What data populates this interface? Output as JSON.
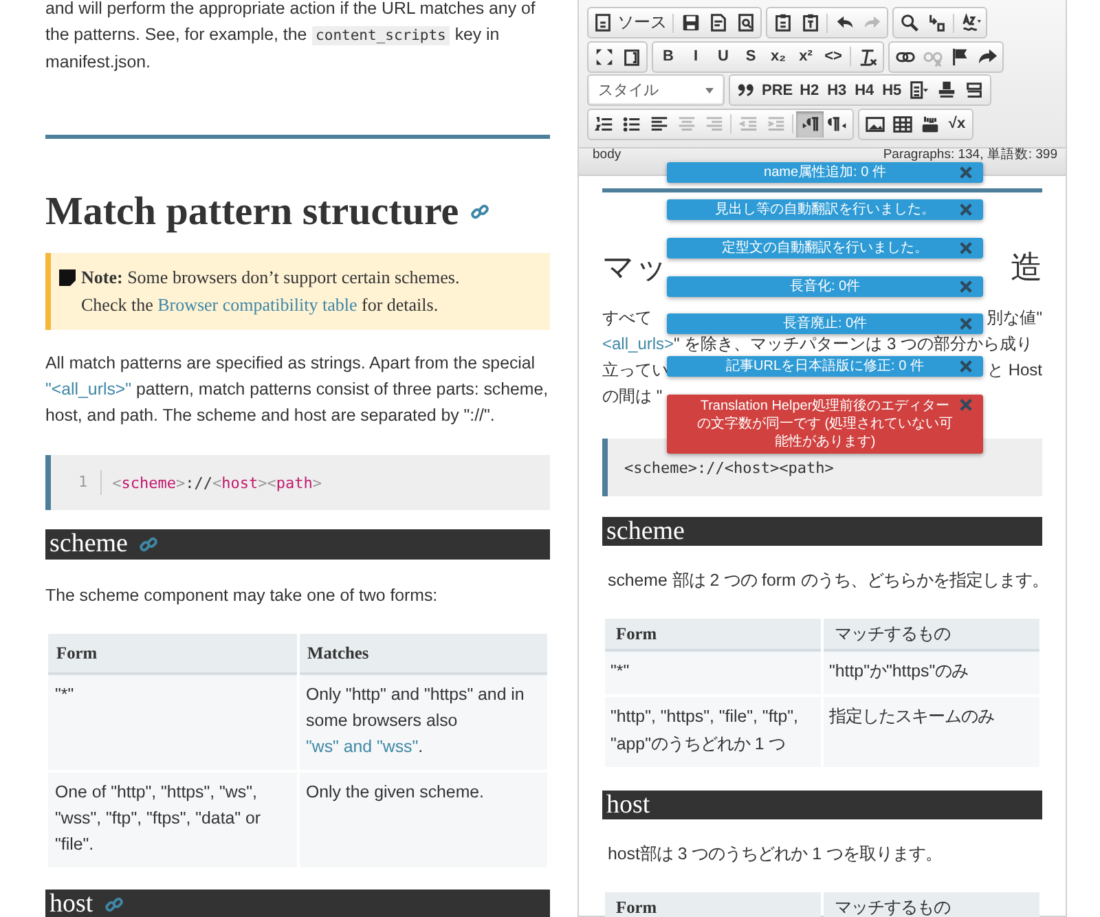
{
  "article": {
    "intro": [
      {
        "text": "and will perform the appropriate action if the URL matches any of the patterns. See, for example, the "
      },
      {
        "text": "content_scripts",
        "kind": "code"
      },
      {
        "text": " key in manifest.json."
      }
    ],
    "heading": "Match pattern structure",
    "note": [
      [
        {
          "text": "Note:",
          "kind": "bold"
        },
        {
          "text": " Some browsers don’t support certain schemes."
        }
      ],
      [
        {
          "text": "Check the "
        },
        {
          "text": "Browser compatibility table",
          "kind": "link"
        },
        {
          "text": " for details."
        }
      ]
    ],
    "paragraph": [
      {
        "text": "All match patterns are specified as strings. Apart from the special "
      },
      {
        "text": "\"<all_urls>\"",
        "kind": "link"
      },
      {
        "text": " pattern, match patterns consist of three parts: scheme, host, and path. The scheme and host are separated by \"://\"."
      }
    ],
    "code": {
      "line_number": "1",
      "tokens": [
        {
          "text": "<",
          "kind": "punct"
        },
        {
          "text": "scheme",
          "kind": "tag"
        },
        {
          "text": ">",
          "kind": "punct"
        },
        {
          "text": "://",
          "kind": "plain"
        },
        {
          "text": "<",
          "kind": "punct"
        },
        {
          "text": "host",
          "kind": "tag"
        },
        {
          "text": ">",
          "kind": "punct"
        },
        {
          "text": "<",
          "kind": "punct"
        },
        {
          "text": "path",
          "kind": "tag"
        },
        {
          "text": ">",
          "kind": "punct"
        }
      ]
    },
    "sections": [
      {
        "heading": "scheme",
        "text": "The scheme component may take one of two forms:",
        "table": {
          "columns": [
            "Form",
            "Matches"
          ],
          "rows": [
            [
              [
                {
                  "text": "\"*\""
                }
              ],
              [
                {
                  "text": "Only \"http\" and \"https\" and in some browsers also "
                },
                {
                  "text": "\"ws\" and \"wss\"",
                  "kind": "link"
                },
                {
                  "text": "."
                }
              ]
            ],
            [
              [
                {
                  "text": "One of \"http\", \"https\", \"ws\", \"wss\", \"ftp\", \"ftps\", \"data\" or \"file\"."
                }
              ],
              [
                {
                  "text": "Only the given scheme."
                }
              ]
            ]
          ]
        }
      },
      {
        "heading": "host"
      }
    ]
  },
  "editor": {
    "toolbar": [
      [
        [
          {
            "kind": "labeled",
            "label": "ソース",
            "disabled": false
          },
          {
            "kind": "separator"
          },
          {
            "kind": "icon",
            "disabled": false
          },
          {
            "kind": "icon",
            "disabled": false
          },
          {
            "kind": "icon",
            "disabled": false
          }
        ],
        [
          {
            "kind": "icon",
            "disabled": false
          },
          {
            "kind": "icon",
            "disabled": false
          },
          {
            "kind": "separator"
          },
          {
            "kind": "icon",
            "disabled": false
          },
          {
            "kind": "icon",
            "disabled": true
          }
        ],
        [
          {
            "kind": "icon",
            "disabled": false
          },
          {
            "kind": "icon",
            "disabled": false
          },
          {
            "kind": "separator"
          },
          {
            "kind": "icon",
            "disabled": false
          }
        ]
      ],
      [
        [
          {
            "kind": "icon",
            "disabled": false,
            "selected": false
          },
          {
            "kind": "icon",
            "disabled": false,
            "selected": false
          }
        ],
        [
          {
            "kind": "text",
            "label": "B",
            "disabled": false,
            "selected": false
          },
          {
            "kind": "text",
            "label": "I",
            "disabled": false,
            "selected": false
          },
          {
            "kind": "text",
            "label": "U",
            "disabled": false,
            "selected": false
          },
          {
            "kind": "text",
            "label": "S",
            "disabled": false,
            "selected": false
          },
          {
            "kind": "text",
            "label": "x₂",
            "disabled": false,
            "selected": false
          },
          {
            "kind": "text",
            "label": "x²",
            "disabled": false,
            "selected": false
          },
          {
            "kind": "text",
            "label": "<>",
            "disabled": false,
            "selected": false
          },
          {
            "kind": "separator"
          },
          {
            "kind": "icon",
            "disabled": false,
            "selected": false
          }
        ],
        [
          {
            "kind": "icon",
            "disabled": false,
            "selected": false
          },
          {
            "kind": "icon",
            "disabled": true,
            "selected": false
          },
          {
            "kind": "icon",
            "disabled": false,
            "selected": false
          },
          {
            "kind": "icon",
            "disabled": false,
            "selected": false
          }
        ]
      ],
      [
        [
          {
            "kind": "select",
            "label": "スタイル"
          }
        ],
        [
          {
            "kind": "icon",
            "disabled": false,
            "selected": false
          },
          {
            "kind": "text",
            "label": "PRE",
            "disabled": false,
            "selected": false
          },
          {
            "kind": "text",
            "label": "H2",
            "disabled": false,
            "selected": false
          },
          {
            "kind": "text",
            "label": "H3",
            "disabled": false,
            "selected": false
          },
          {
            "kind": "text",
            "label": "H4",
            "disabled": false,
            "selected": false
          },
          {
            "kind": "text",
            "label": "H5",
            "disabled": false,
            "selected": false
          },
          {
            "kind": "icon",
            "disabled": false,
            "selected": false
          },
          {
            "kind": "icon",
            "disabled": false,
            "selected": false
          },
          {
            "kind": "icon",
            "disabled": false,
            "selected": false
          }
        ]
      ],
      [
        [
          {
            "kind": "icon",
            "disabled": false,
            "selected": false
          },
          {
            "kind": "icon",
            "disabled": false,
            "selected": false
          },
          {
            "kind": "icon",
            "disabled": false,
            "selected": false
          },
          {
            "kind": "icon",
            "disabled": true,
            "selected": false
          },
          {
            "kind": "icon",
            "disabled": true,
            "selected": false
          },
          {
            "kind": "separator"
          },
          {
            "kind": "icon",
            "disabled": true,
            "selected": false
          },
          {
            "kind": "icon",
            "disabled": true,
            "selected": false
          },
          {
            "kind": "separator"
          },
          {
            "kind": "icon",
            "disabled": false,
            "selected": true
          },
          {
            "kind": "icon",
            "disabled": false,
            "selected": false
          }
        ],
        [
          {
            "kind": "icon",
            "disabled": false,
            "selected": false
          },
          {
            "kind": "icon",
            "disabled": false,
            "selected": false
          },
          {
            "kind": "icon",
            "disabled": false,
            "selected": false
          },
          {
            "kind": "text",
            "label": "√x",
            "disabled": false,
            "selected": false
          }
        ]
      ]
    ],
    "status": {
      "path": "body",
      "counts": "Paragraphs: 134, 単語数: 399"
    },
    "heading": {
      "left": "マッ",
      "right": "造"
    },
    "lines": [
      {
        "left": [
          {
            "text": "すべて"
          }
        ],
        "right": [
          {
            "text": "別な値\""
          }
        ]
      },
      {
        "left": [
          {
            "text": "<all_urls>",
            "kind": "link"
          },
          {
            "text": "\" を除き、マッチパターンは 3 つの部分から成り"
          }
        ]
      },
      {
        "left": [
          {
            "text": "立ってい"
          }
        ],
        "right": [
          {
            "text": "と Host"
          }
        ]
      },
      {
        "left": [
          {
            "text": "の間は \""
          }
        ]
      }
    ],
    "code": "<scheme>://<host><path>",
    "sections": [
      {
        "heading": "scheme",
        "text": "scheme 部は 2 つの form のうち、どちらかを指定します。",
        "table": {
          "columns": [
            "Form",
            "マッチするもの"
          ],
          "rows": [
            [
              "\"*\"",
              "\"http\"か\"https\"のみ"
            ],
            [
              "\"http\", \"https\", \"file\", \"ftp\", \"app\"のうちどれか 1 つ",
              "指定したスキームのみ"
            ]
          ]
        }
      },
      {
        "heading": "host",
        "text": "host部は 3 つのうちどれか 1 つを取ります。",
        "table": {
          "columns": [
            "Form",
            "マッチするもの"
          ]
        }
      }
    ]
  },
  "notifications": [
    {
      "text": "name属性追加: 0 件",
      "kind": "info"
    },
    {
      "text": "見出し等の自動翻訳を行いました。",
      "kind": "info"
    },
    {
      "text": "定型文の自動翻訳を行いました。",
      "kind": "info"
    },
    {
      "text": "長音化: 0件",
      "kind": "info"
    },
    {
      "text": "長音廃止: 0件",
      "kind": "info"
    },
    {
      "text": "記事URLを日本語版に修正: 0 件",
      "kind": "info"
    },
    {
      "text": "Translation Helper処理前後のエディターの文字数が同一です (処理されていない可能性があります)",
      "kind": "error"
    }
  ]
}
